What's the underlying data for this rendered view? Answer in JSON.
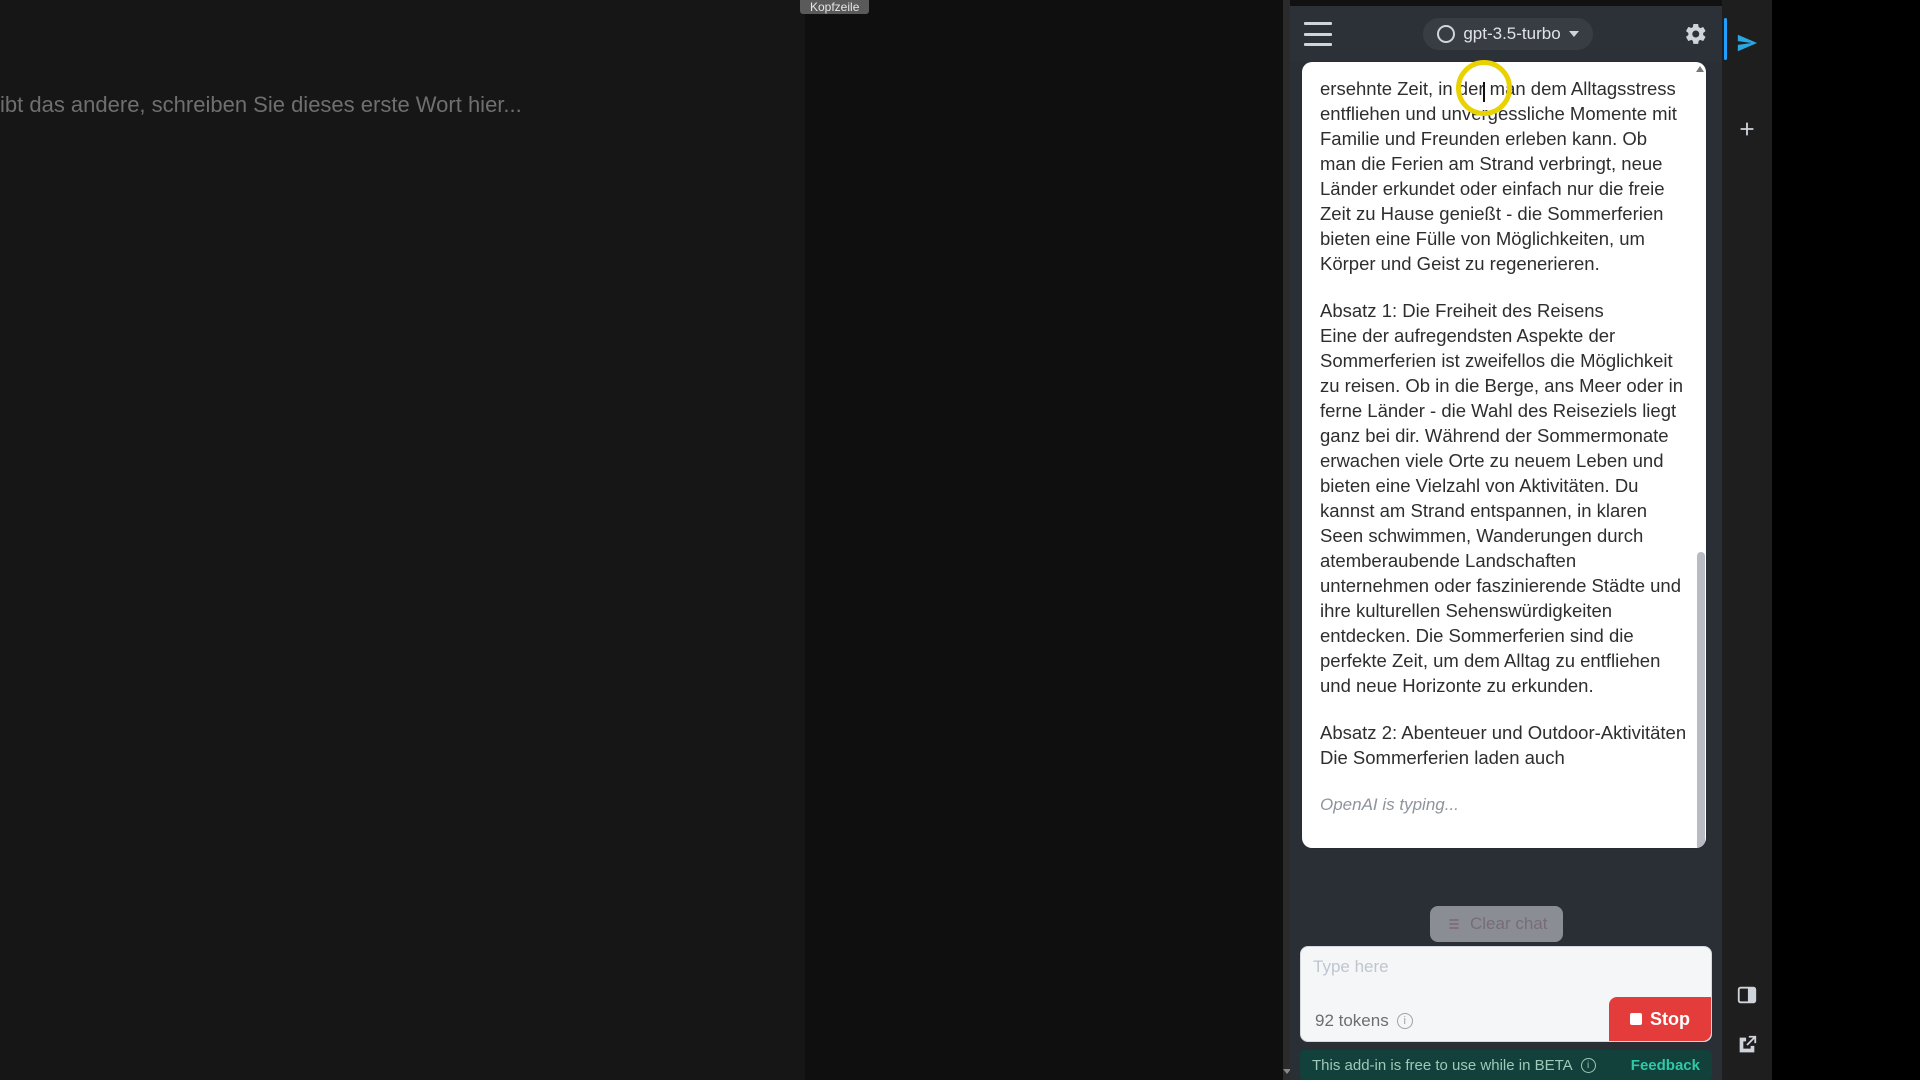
{
  "host": {
    "kopfzeile": "Kopfzeile",
    "doc_placeholder": "ibt das andere, schreiben Sie dieses erste Wort hier..."
  },
  "panel": {
    "model_label": "gpt-3.5-turbo",
    "chat": {
      "para0": "ersehnte Zeit, in der man dem Alltagsstress entfliehen und unvergessliche Momente mit Familie und Freunden erleben kann. Ob man die Ferien am Strand verbringt, neue Länder erkundet oder einfach nur die freie Zeit zu Hause genießt - die Sommerferien bieten eine Fülle von Möglichkeiten, um Körper und Geist zu regenerieren.",
      "h1": "Absatz 1: Die Freiheit des Reisens",
      "para1": "Eine der aufregendsten Aspekte der Sommerferien ist zweifellos die Möglichkeit zu reisen. Ob in die Berge, ans Meer oder in ferne Länder - die Wahl des Reiseziels liegt ganz bei dir. Während der Sommermonate erwachen viele Orte zu neuem Leben und bieten eine Vielzahl von Aktivitäten. Du kannst am Strand entspannen, in klaren Seen schwimmen, Wanderungen durch atemberaubende Landschaften unternehmen oder faszinierende Städte und ihre kulturellen Sehenswürdigkeiten entdecken. Die Sommerferien sind die perfekte Zeit, um dem Alltag zu entfliehen und neue Horizonte zu erkunden.",
      "h2": "Absatz 2: Abenteuer und Outdoor-Aktivitäten",
      "para2": "Die Sommerferien laden auch",
      "typing": "OpenAI is typing..."
    },
    "clear_label": "Clear chat",
    "input_placeholder": "Type here",
    "tokens": "92 tokens",
    "stop_label": "Stop",
    "beta_text": "This add-in is free to use while in BETA",
    "feedback_label": "Feedback"
  }
}
